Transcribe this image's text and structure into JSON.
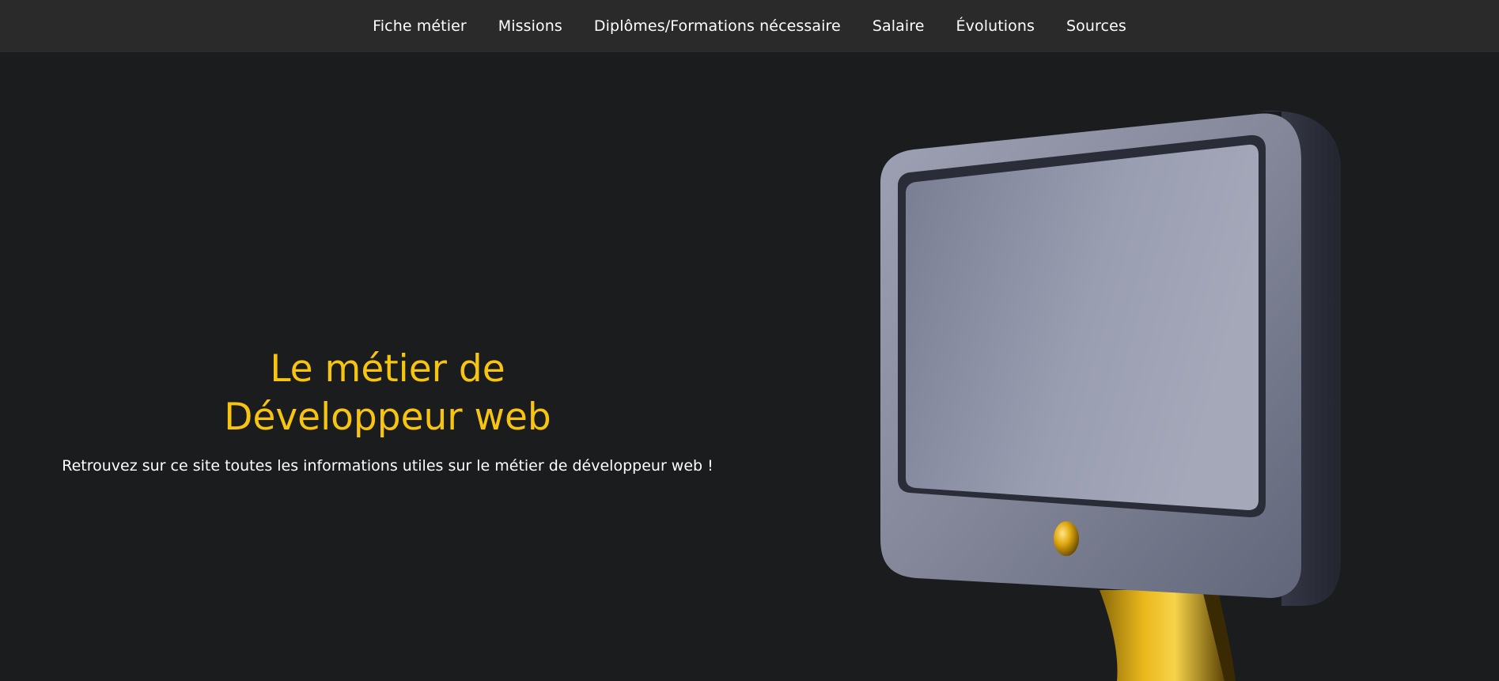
{
  "nav": {
    "items": [
      {
        "label": "Fiche métier"
      },
      {
        "label": "Missions"
      },
      {
        "label": "Diplômes/Formations nécessaire"
      },
      {
        "label": "Salaire"
      },
      {
        "label": "Évolutions"
      },
      {
        "label": "Sources"
      }
    ]
  },
  "hero": {
    "title_line1": "Le métier de",
    "title_line2": "Développeur web",
    "subtitle": "Retrouvez sur ce site toutes les informations utiles sur le métier de développeur web !"
  },
  "colors": {
    "background": "#1b1c1e",
    "navbar": "#2a2a2a",
    "accent": "#f7c510",
    "text": "#ffffff"
  },
  "illustration": {
    "icon": "monitor-3d-icon"
  }
}
